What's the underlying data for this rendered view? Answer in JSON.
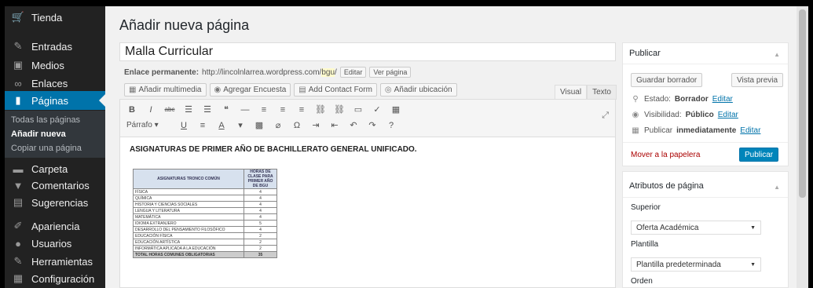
{
  "sidebar": {
    "items": [
      {
        "label": "Tienda",
        "icon": "cart-icon",
        "glyph": "🛒"
      },
      {
        "label": "Entradas",
        "icon": "pin-icon",
        "glyph": "✎"
      },
      {
        "label": "Medios",
        "icon": "media-icon",
        "glyph": "▣"
      },
      {
        "label": "Enlaces",
        "icon": "link-icon",
        "glyph": "∞"
      },
      {
        "label": "Páginas",
        "icon": "pages-icon",
        "glyph": "▮"
      },
      {
        "label": "Carpeta",
        "icon": "folder-icon",
        "glyph": "▬"
      },
      {
        "label": "Comentarios",
        "icon": "comment-icon",
        "glyph": "▼"
      },
      {
        "label": "Sugerencias",
        "icon": "suggestions-icon",
        "glyph": "▤"
      },
      {
        "label": "Apariencia",
        "icon": "brush-icon",
        "glyph": "✐"
      },
      {
        "label": "Usuarios",
        "icon": "users-icon",
        "glyph": "●"
      },
      {
        "label": "Herramientas",
        "icon": "wrench-icon",
        "glyph": "✎"
      },
      {
        "label": "Configuración",
        "icon": "settings-icon",
        "glyph": "▦"
      }
    ],
    "submenu": [
      "Todas las páginas",
      "Añadir nueva",
      "Copiar una página"
    ]
  },
  "page_title": "Añadir nueva página",
  "post_title": "Malla Curricular",
  "permalink": {
    "label": "Enlace permanente:",
    "url": "http://lincolnlarrea.wordpress.com/",
    "slug": "bgu",
    "trail": "/",
    "edit_label": "Editar",
    "view_label": "Ver página"
  },
  "media_buttons": [
    {
      "label": "Añadir multimedia",
      "icon": "media-add-icon",
      "glyph": "▦"
    },
    {
      "label": "Agregar Encuesta",
      "icon": "poll-icon",
      "glyph": "◉"
    },
    {
      "label": "Add Contact Form",
      "icon": "contact-form-icon",
      "glyph": "▤"
    },
    {
      "label": "Añadir ubicación",
      "icon": "location-icon",
      "glyph": "◎"
    }
  ],
  "editor_tabs": {
    "visual": "Visual",
    "text": "Texto"
  },
  "toolbar": {
    "row1": [
      "B",
      "I",
      "abc",
      "☰",
      "☰",
      "❝",
      "—",
      "≡",
      "≡",
      "≡",
      "⛓",
      "⛓",
      "▭",
      "✓",
      "▦"
    ],
    "row2": [
      "U",
      "≡",
      "A",
      "▾",
      "▩",
      "⌀",
      "Ω",
      "⇥",
      "⇤",
      "↶",
      "↷",
      "?"
    ],
    "format_value": "Párrafo"
  },
  "content": {
    "heading": "ASIGNATURAS DE PRIMER AÑO DE BACHILLERATO GENERAL UNIFICADO.",
    "table": {
      "headers": [
        "ASIGNATURAS TRONCO COMÚN",
        "HORAS DE CLASE PARA PRIMER AÑO DE BGU"
      ],
      "rows": [
        [
          "FÍSICA",
          "4"
        ],
        [
          "QUÍMICA",
          "4"
        ],
        [
          "HISTORIA Y CIENCIAS SOCIALES",
          "4"
        ],
        [
          "LENGUA Y LITERATURA",
          "4"
        ],
        [
          "MATEMÁTICA",
          "4"
        ],
        [
          "IDIOMA EXTRANJERO",
          "5"
        ],
        [
          "DESARROLLO DEL PENSAMIENTO FILOSÓFICO",
          "4"
        ],
        [
          "EDUCACIÓN FÍSICA",
          "2"
        ],
        [
          "EDUCACIÓN ARTÍSTICA",
          "2"
        ],
        [
          "INFORMÁTICA APLICADA A LA EDUCACIÓN",
          "2"
        ]
      ],
      "total": [
        "TOTAL HORAS COMUNES OBLIGATORIAS",
        "35"
      ]
    }
  },
  "publish": {
    "title": "Publicar",
    "save_draft": "Guardar borrador",
    "preview": "Vista previa",
    "status_label": "Estado:",
    "status_value": "Borrador",
    "visibility_label": "Visibilidad:",
    "visibility_value": "Público",
    "schedule_label": "Publicar",
    "schedule_value": "inmediatamente",
    "edit_link": "Editar",
    "trash": "Mover a la papelera",
    "publish_button": "Publicar"
  },
  "attributes": {
    "title": "Atributos de página",
    "parent_label": "Superior",
    "parent_value": "Oferta Académica",
    "template_label": "Plantilla",
    "template_value": "Plantilla predeterminada",
    "order_label": "Orden"
  },
  "colors": {
    "accent": "#0073aa",
    "sidebar": "#222222",
    "publish": "#0085ba"
  }
}
